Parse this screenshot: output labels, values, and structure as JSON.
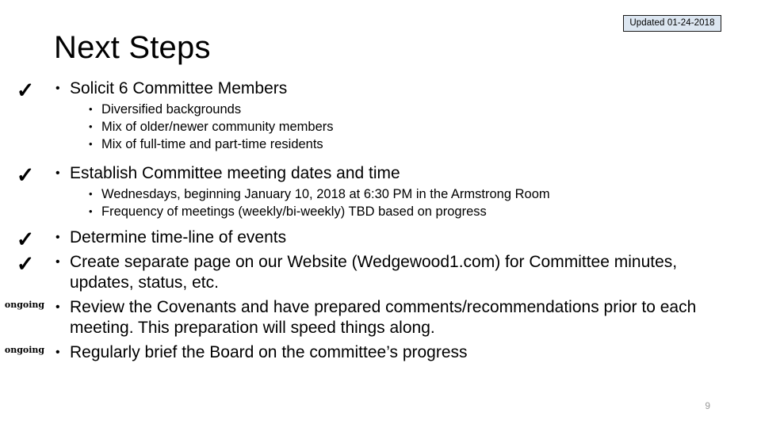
{
  "slide": {
    "title": "Next Steps",
    "page_number": "9",
    "updated_badge": "Updated 01-24-2018",
    "badge_fill": "#dce6f1",
    "badge_border": "#1a1a1a",
    "page_number_color": "#9a9a9a",
    "bullet_glyph": "•",
    "check_glyph": "✓"
  },
  "items": [
    {
      "marker": "check",
      "marker_label": "✓",
      "text": "Solicit 6 Committee Members",
      "sub": [
        "Diversified backgrounds",
        "Mix of older/newer community members",
        "Mix of full-time and part-time residents"
      ]
    },
    {
      "marker": "check",
      "marker_label": "✓",
      "text": "Establish Committee meeting dates and time",
      "sub": [
        "Wednesdays, beginning January 10, 2018 at 6:30 PM in the Armstrong Room",
        "Frequency of meetings (weekly/bi-weekly) TBD based on progress"
      ]
    },
    {
      "marker": "check",
      "marker_label": "✓",
      "text": "Determine time-line of events",
      "sub": []
    },
    {
      "marker": "check",
      "marker_label": "✓",
      "text": "Create separate page on our Website (Wedgewood1.com) for Committee minutes, updates, status, etc.",
      "sub": []
    },
    {
      "marker": "ongoing",
      "marker_label": "ongoing",
      "text": "Review the Covenants and have prepared comments/recommendations prior to each meeting.  This preparation will speed things along.",
      "sub": []
    },
    {
      "marker": "ongoing",
      "marker_label": "ongoing",
      "text": "Regularly brief the Board on the committee’s progress",
      "sub": []
    }
  ]
}
